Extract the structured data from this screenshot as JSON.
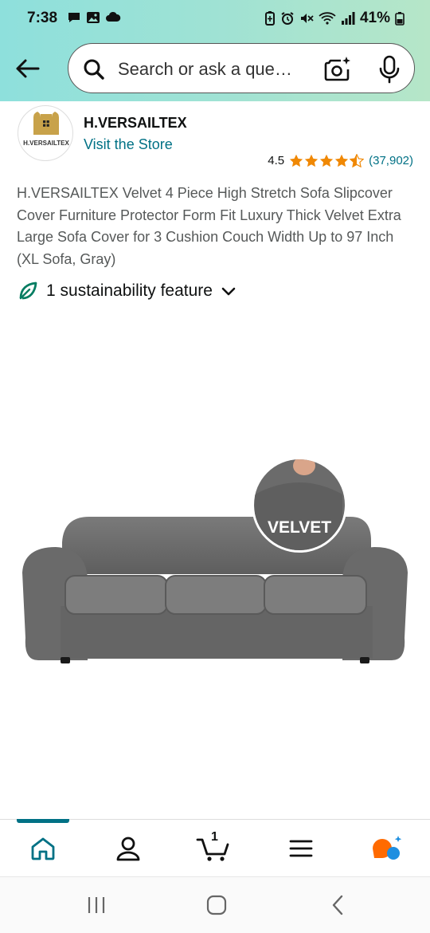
{
  "status_bar": {
    "time": "7:38",
    "battery_percent": "41%",
    "left_icons": [
      "chat-bubble-icon",
      "image-icon",
      "cloud-icon"
    ],
    "right_icons": [
      "battery-saver-icon",
      "alarm-icon",
      "mute-icon",
      "wifi-icon",
      "signal-icon",
      "battery-icon"
    ]
  },
  "search": {
    "placeholder": "Search or ask a que…"
  },
  "brand": {
    "logo_text": "H.VERSAILTEX",
    "name": "H.VERSAILTEX",
    "visit_store": "Visit the Store"
  },
  "rating": {
    "value": "4.5",
    "stars": 4.5,
    "count": "(37,902)"
  },
  "product": {
    "title": "H.VERSAILTEX Velvet 4 Piece High Stretch Sofa Slipcover Cover Furniture Protector Form Fit Luxury Thick Velvet Extra Large Sofa Cover for 3 Cushion Couch Width Up to 97 Inch (XL Sofa, Gray)",
    "image_badge": "VELVET"
  },
  "sustainability": {
    "label": "1 sustainability feature"
  },
  "bottom_nav": {
    "items": [
      "home-icon",
      "account-icon",
      "cart-icon",
      "menu-icon",
      "rufus-icon"
    ],
    "cart_count": "1",
    "active": "home"
  },
  "colors": {
    "header_gradient_start": "#8ee0dc",
    "header_gradient_end": "#b6e6c8",
    "link": "#007185",
    "star": "#f08804",
    "sustain_green": "#067d62",
    "sofa_gray": "#6f6f6f"
  }
}
